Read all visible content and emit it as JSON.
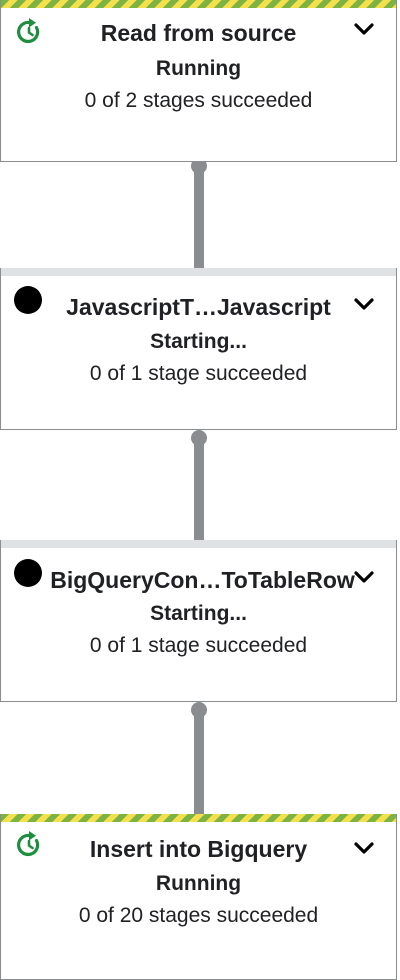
{
  "colors": {
    "running_stripe_green": "#7cb342",
    "running_stripe_yellow": "#f4e04d",
    "running_icon": "#1e8e3e",
    "pending_stripe": "#dfe1e3",
    "pending_dot": "#000000",
    "connector": "#8a8d90"
  },
  "steps": [
    {
      "title": "Read from source",
      "state": "Running",
      "stages": "0 of 2 stages succeeded",
      "status_icon": "running-refresh-icon"
    },
    {
      "title": "JavascriptT…Javascript",
      "state": "Starting...",
      "stages": "0 of 1 stage succeeded",
      "status_icon": "pending-dot-icon"
    },
    {
      "title": "BigQueryCon…ToTableRow",
      "state": "Starting...",
      "stages": "0 of 1 stage succeeded",
      "status_icon": "pending-dot-icon"
    },
    {
      "title": "Insert into Bigquery",
      "state": "Running",
      "stages": "0 of 20 stages succeeded",
      "status_icon": "running-refresh-icon"
    }
  ]
}
